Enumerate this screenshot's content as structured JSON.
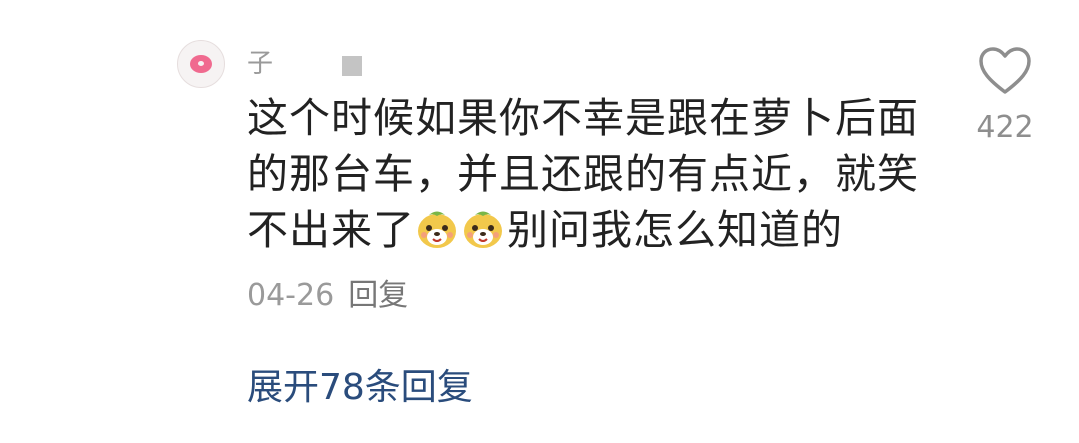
{
  "comment": {
    "username": "子",
    "avatar_icon": "donut-avatar",
    "text_part1": "这个时候如果你不幸是跟在萝卜后面的那台车，并且还跟的有点近，就笑不出来了",
    "emoji_icon": "laughing-dog-emoji",
    "text_part2": "别问我怎么知道的",
    "date": "04-26",
    "reply_label": "回复",
    "like_icon": "heart-outline-icon",
    "like_count": "422"
  },
  "replies": {
    "expand_label": "展开78条回复"
  },
  "colors": {
    "text": "#222222",
    "meta": "#9a9a9a",
    "link": "#2a4c7c",
    "avatar_accent": "#f06a8f"
  }
}
